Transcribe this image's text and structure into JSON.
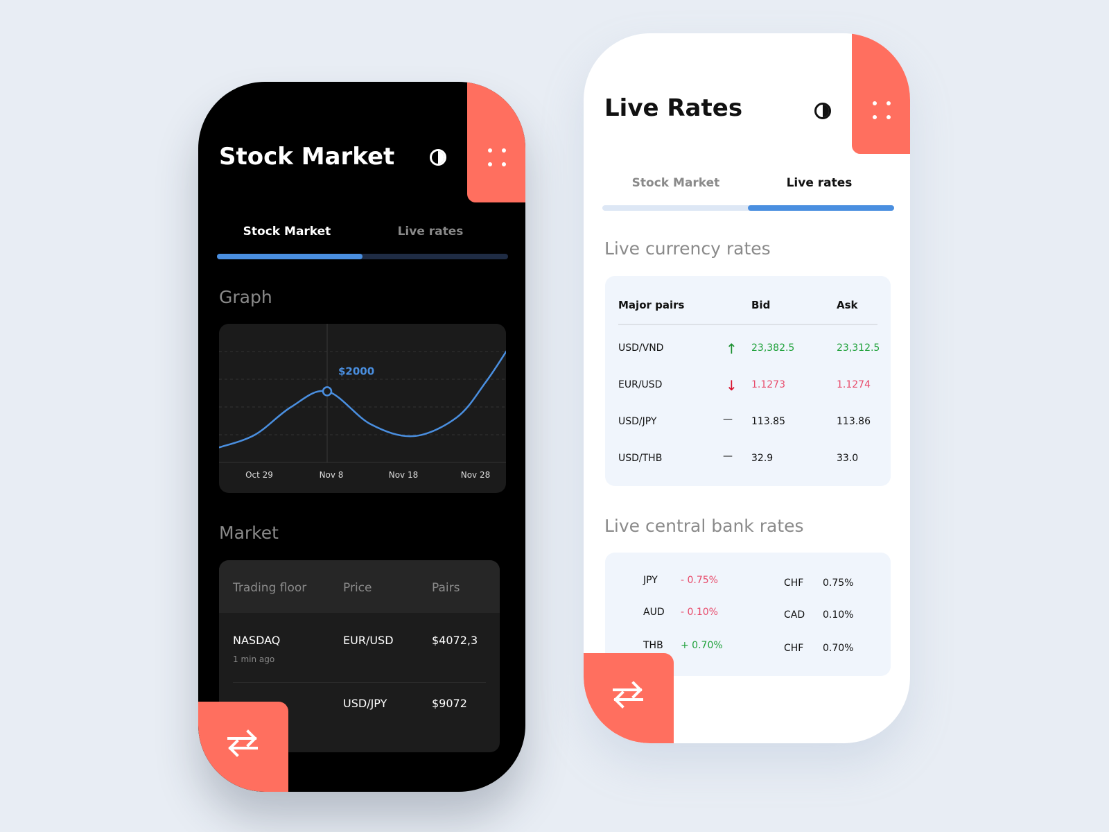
{
  "colors": {
    "accent": "#ff6f5f",
    "blue": "#4a8fe0",
    "up": "#1fa13a",
    "down": "#e84a6a"
  },
  "dark_phone": {
    "title": "Stock Market",
    "icons": {
      "theme": "contrast-icon",
      "menu": "dots-grid-icon",
      "fab": "swap-arrows-icon"
    },
    "tabs": [
      {
        "label": "Stock Market",
        "active": true
      },
      {
        "label": "Live rates",
        "active": false
      }
    ],
    "tab_progress": 0.5,
    "graph_heading": "Graph",
    "market_heading": "Market",
    "market_table": {
      "headers": [
        "Trading floor",
        "Price",
        "Pairs"
      ],
      "rows": [
        {
          "floor": "NASDAQ",
          "time": "1 min ago",
          "price": "EUR/USD",
          "pairs": "$4072,3"
        },
        {
          "floor": "",
          "time": "",
          "price": "USD/JPY",
          "pairs": "$9072"
        }
      ]
    }
  },
  "chart_data": {
    "type": "line",
    "x_ticks": [
      "Oct 29",
      "Nov 8",
      "Nov 18",
      "Nov 28"
    ],
    "x": [
      "Oct 24",
      "Oct 29",
      "Nov 3",
      "Nov 8",
      "Nov 14",
      "Nov 20",
      "Nov 26",
      "Nov 30",
      "Dec 3"
    ],
    "values": [
      420,
      780,
      1560,
      2000,
      1080,
      740,
      1270,
      2260,
      3170
    ],
    "highlight": {
      "x": "Nov 8",
      "label": "$2000"
    },
    "ylim": [
      0,
      3900
    ],
    "grid": "horizontal dashed",
    "color": "#4a8fe0"
  },
  "light_phone": {
    "title": "Live Rates",
    "tabs": [
      {
        "label": "Stock Market",
        "active": false
      },
      {
        "label": "Live rates",
        "active": true
      }
    ],
    "tab_progress": 0.5,
    "currency_heading": "Live currency rates",
    "currency_table": {
      "headers": [
        "Major pairs",
        "Bid",
        "Ask"
      ],
      "rows": [
        {
          "pair": "USD/VND",
          "trend": "up",
          "bid": "23,382.5",
          "ask": "23,312.5"
        },
        {
          "pair": "EUR/USD",
          "trend": "down",
          "bid": "1.1273",
          "ask": "1.1274"
        },
        {
          "pair": "USD/JPY",
          "trend": "flat",
          "bid": "113.85",
          "ask": "113.86"
        },
        {
          "pair": "USD/THB",
          "trend": "flat",
          "bid": "32.9",
          "ask": "33.0"
        }
      ]
    },
    "bank_heading": "Live central bank rates",
    "bank_rates": [
      {
        "left_code": "JPY",
        "left_rate": "- 0.75%",
        "left_trend": "down",
        "right_code": "CHF",
        "right_rate": "0.75%"
      },
      {
        "left_code": "AUD",
        "left_rate": "- 0.10%",
        "left_trend": "down",
        "right_code": "CAD",
        "right_rate": "0.10%"
      },
      {
        "left_code": "THB",
        "left_rate": "+ 0.70%",
        "left_trend": "up",
        "right_code": "CHF",
        "right_rate": "0.70%"
      }
    ]
  }
}
